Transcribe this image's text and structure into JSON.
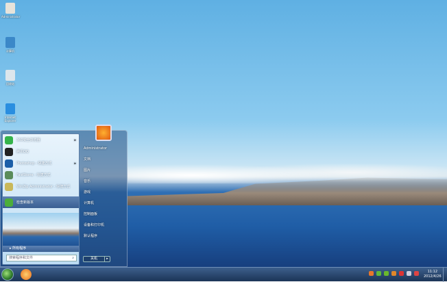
{
  "desktop": {
    "icons": [
      {
        "label": "Administrator",
        "icon": "user-folder-icon",
        "color": "#e7e3da"
      },
      {
        "label": "计算机",
        "icon": "computer-icon",
        "color": "#3b88c8"
      },
      {
        "label": "回收站",
        "icon": "recycle-bin-icon",
        "color": "#dde6ec"
      },
      {
        "label": "Internet Explorer",
        "icon": "ie-icon",
        "color": "#2a8ee0"
      }
    ]
  },
  "start_menu": {
    "programs": [
      {
        "label": "360安全浏览器",
        "icon": "browser-360-icon",
        "color": "#35b34a",
        "submenu": true
      },
      {
        "label": "腾讯QQ",
        "icon": "qq-icon",
        "color": "#222222",
        "submenu": false
      },
      {
        "label": "Photoshop - 快捷方式",
        "icon": "photoshop-icon",
        "color": "#1c5fa8",
        "submenu": true
      },
      {
        "label": "FastStone - 快捷方式",
        "icon": "faststone-icon",
        "color": "#5b8c5a",
        "submenu": false
      },
      {
        "label": "WinZip Administrator - 快捷方式",
        "icon": "pen-icon",
        "color": "#c9b85a",
        "submenu": false
      },
      {
        "label": "检查新版本",
        "icon": "update-icon",
        "color": "#4cae3a",
        "submenu": false
      }
    ],
    "all_programs": "所有程序",
    "search_placeholder": "搜索程序和文件",
    "right_items": [
      "Administrator",
      "文档",
      "图片",
      "音乐",
      "游戏",
      "计算机",
      "控制面板",
      "设备和打印机",
      "默认程序"
    ],
    "shutdown": "关机"
  },
  "taskbar": {
    "clock_time": "11:12",
    "clock_date": "2012/4/26",
    "tray_colors": [
      "#e8762b",
      "#5fb93a",
      "#6ab82c",
      "#e0872a",
      "#d33",
      "#ccd",
      "#d44"
    ]
  }
}
